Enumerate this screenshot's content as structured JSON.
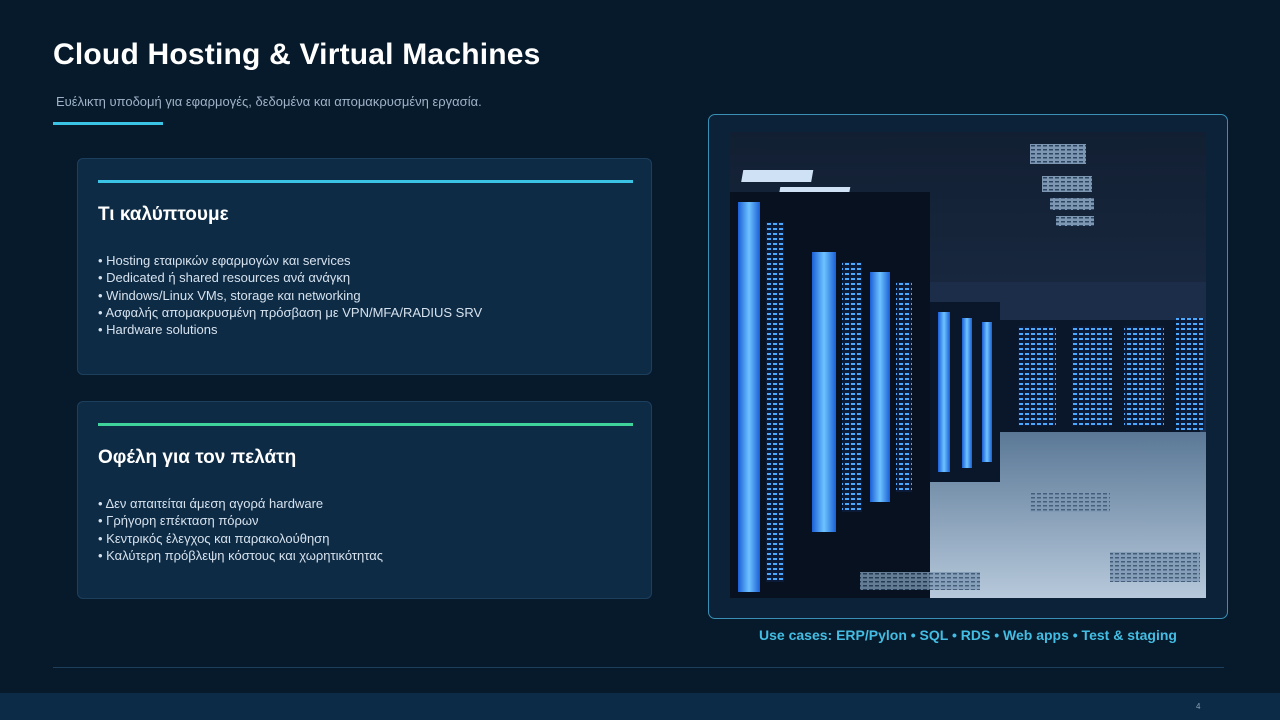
{
  "slide": {
    "title": "Cloud Hosting & Virtual Machines",
    "subtitle": "Ευέλικτη υποδομή για εφαρμογές, δεδομένα και απομακρυσμένη εργασία.",
    "accent_color": "#3bc3e6",
    "secondary_accent": "#3fd39b",
    "page_number": "4"
  },
  "card_coverage": {
    "title": "Τι καλύπτουμε",
    "items": [
      "Hosting εταιρικών εφαρμογών και services",
      "Dedicated ή shared resources ανά ανάγκη",
      "Windows/Linux VMs, storage και networking",
      "Ασφαλής απομακρυσμένη πρόσβαση με VPN/MFA/RADIUS SRV",
      "Hardware solutions"
    ]
  },
  "card_benefits": {
    "title": "Οφέλη για τον πελάτη",
    "items": [
      "Δεν απαιτείται άμεση αγορά hardware",
      "Γρήγορη επέκταση πόρων",
      "Κεντρικός έλεγχος και παρακολούθηση",
      "Καλύτερη πρόβλεψη κόστους και χωρητικότητας"
    ]
  },
  "photo": {
    "subject": "data-center-server-room"
  },
  "use_cases": "Use cases: ERP/Pylon • SQL • RDS • Web apps • Test & staging"
}
